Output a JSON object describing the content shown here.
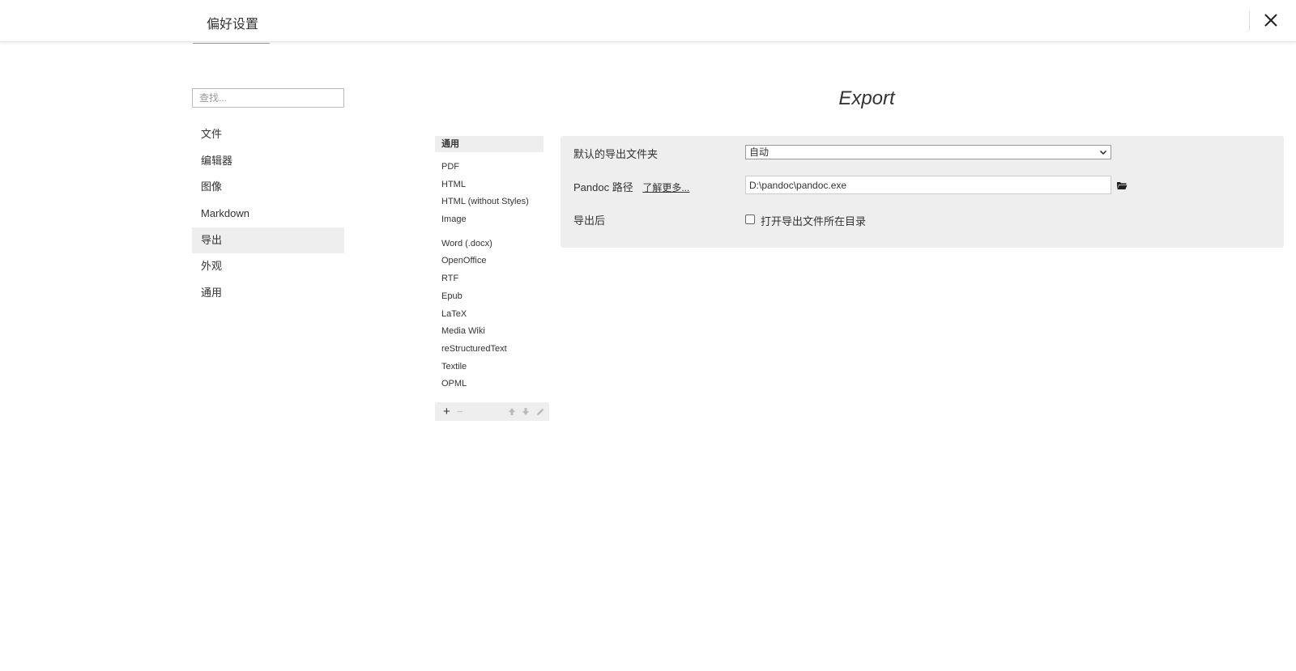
{
  "window": {
    "title": "偏好设置"
  },
  "sidebar": {
    "search_placeholder": "查找...",
    "items": [
      {
        "label": "文件"
      },
      {
        "label": "编辑器"
      },
      {
        "label": "图像"
      },
      {
        "label": "Markdown"
      },
      {
        "label": "导出",
        "active": true
      },
      {
        "label": "外观"
      },
      {
        "label": "通用"
      }
    ]
  },
  "main": {
    "title": "Export",
    "formats": {
      "header": "通用",
      "group1": [
        "PDF",
        "HTML",
        "HTML (without Styles)",
        "Image"
      ],
      "group2": [
        "Word (.docx)",
        "OpenOffice",
        "RTF",
        "Epub",
        "LaTeX",
        "Media Wiki",
        "reStructuredText",
        "Textile",
        "OPML"
      ],
      "toolbar": {
        "add": "+",
        "remove": "−"
      }
    },
    "settings": {
      "export_folder": {
        "label": "默认的导出文件夹",
        "value": "自动"
      },
      "pandoc": {
        "label": "Pandoc 路径",
        "learn_more": "了解更多...",
        "value": "D:\\pandoc\\pandoc.exe"
      },
      "after_export": {
        "label": "导出后",
        "checkbox_label": "打开导出文件所在目录",
        "checked": false
      }
    }
  }
}
